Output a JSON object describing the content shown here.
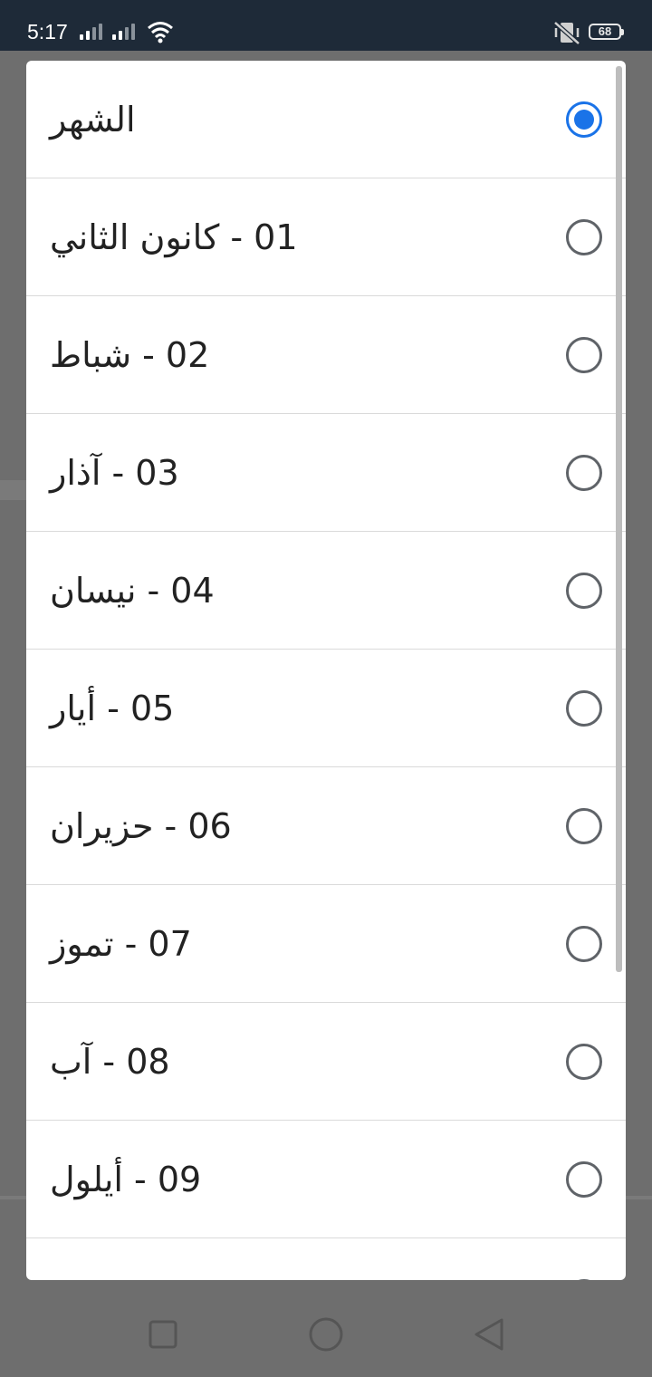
{
  "status_bar": {
    "time": "5:17",
    "battery": "68",
    "icons": [
      "signal-icon",
      "signal-icon",
      "wifi-icon",
      "vibrate-off-icon",
      "battery-icon"
    ]
  },
  "dialog": {
    "selected_index": 0,
    "accent_color": "#1a73e8",
    "options": [
      {
        "label": "الشهر",
        "checked": true
      },
      {
        "label": "01 - كانون الثاني",
        "checked": false
      },
      {
        "label": "02 - شباط",
        "checked": false
      },
      {
        "label": "03 - آذار",
        "checked": false
      },
      {
        "label": "04 - نيسان",
        "checked": false
      },
      {
        "label": "05 - أيار",
        "checked": false
      },
      {
        "label": "06 - حزيران",
        "checked": false
      },
      {
        "label": "07 - تموز",
        "checked": false
      },
      {
        "label": "08 - آب",
        "checked": false
      },
      {
        "label": "09 - أيلول",
        "checked": false
      }
    ]
  },
  "nav_bar": {
    "icons": [
      "recents-square-icon",
      "home-circle-icon",
      "back-triangle-icon"
    ]
  }
}
